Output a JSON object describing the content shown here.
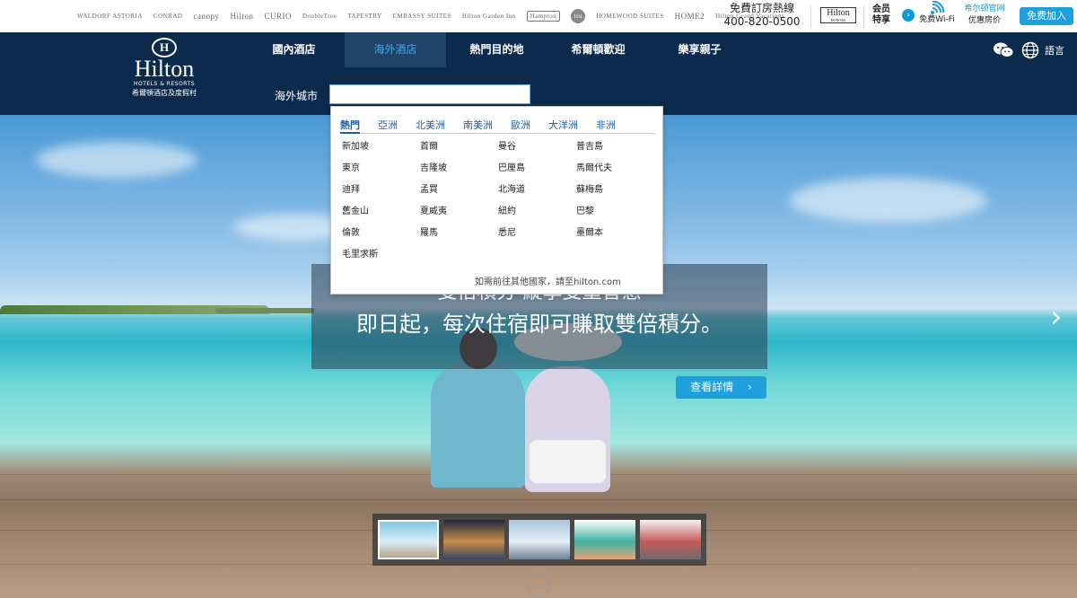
{
  "brands": [
    {
      "name": "WALDORF ASTORIA",
      "style": "small"
    },
    {
      "name": "CONRAD",
      "style": "small"
    },
    {
      "name": "canopy",
      "style": "big"
    },
    {
      "name": "Hilton",
      "style": "big"
    },
    {
      "name": "CURIO",
      "style": "big"
    },
    {
      "name": "DoubleTree",
      "style": "small"
    },
    {
      "name": "TAPESTRY",
      "style": "small"
    },
    {
      "name": "EMBASSY SUITES",
      "style": "small"
    },
    {
      "name": "Hilton Garden Inn",
      "style": "small"
    },
    {
      "name": "Hampton",
      "style": "box"
    },
    {
      "name": "tru",
      "style": "circle"
    },
    {
      "name": "HOMEWOOD SUITES",
      "style": "small"
    },
    {
      "name": "HOME2",
      "style": "big"
    },
    {
      "name": "Hilton Grand Vacations",
      "style": "small"
    }
  ],
  "topbar": {
    "hotline_label": "免費訂房熱線",
    "hotline_number": "400-820-0500",
    "honors_name": "Hilton",
    "honors_sub": "HONORS",
    "member_line1": "会员",
    "member_line2": "特享",
    "wifi_label": "免费Wi-Fi",
    "official_line1": "希尔顿官网",
    "official_line2": "优惠房价",
    "join_label": "免费加入"
  },
  "logo": {
    "mark": "H",
    "name": "Hilton",
    "sub": "HOTELS & RESORTS",
    "cn": "希爾頓酒店及度假村"
  },
  "nav": {
    "tabs": [
      {
        "label": "國內酒店",
        "active": false
      },
      {
        "label": "海外酒店",
        "active": true
      },
      {
        "label": "熱門目的地",
        "active": false
      },
      {
        "label": "希爾頓歡迎",
        "active": false
      },
      {
        "label": "樂享親子",
        "active": false
      }
    ],
    "lang_label": "語言",
    "search_label": "海外城市",
    "search_value": ""
  },
  "dropdown": {
    "regions": [
      {
        "label": "熱門",
        "active": true
      },
      {
        "label": "亞洲",
        "active": false
      },
      {
        "label": "北美洲",
        "active": false
      },
      {
        "label": "南美洲",
        "active": false
      },
      {
        "label": "歐洲",
        "active": false
      },
      {
        "label": "大洋洲",
        "active": false
      },
      {
        "label": "非洲",
        "active": false
      }
    ],
    "cities": [
      "新加坡",
      "首爾",
      "曼谷",
      "普吉島",
      "東京",
      "吉隆坡",
      "巴厘島",
      "馬爾代夫",
      "迪拜",
      "孟買",
      "北海道",
      "蘇梅島",
      "舊金山",
      "夏威夷",
      "紐約",
      "巴黎",
      "倫敦",
      "羅馬",
      "悉尼",
      "墨爾本",
      "毛里求斯"
    ],
    "note": "如需前往其他國家，請至hilton.com"
  },
  "hero": {
    "banner_line1": "雙倍積分 縱享雙重智慧",
    "banner_line2": "即日起，每次住宿即可賺取雙倍積分。",
    "details_label": "查看詳情",
    "details_arrow": "›",
    "next_arrow": "›",
    "scroll_icon": "⌄",
    "thumbnails": [
      {
        "colors": [
          "#7fc6e4",
          "#d9eef6",
          "#b8a48e"
        ],
        "active": true
      },
      {
        "colors": [
          "#1d2a3e",
          "#c98b4a",
          "#354661"
        ],
        "active": false
      },
      {
        "colors": [
          "#aac4dc",
          "#e6eef5",
          "#6f8094"
        ],
        "active": false
      },
      {
        "colors": [
          "#ffffff",
          "#3fb39f",
          "#e6a37c"
        ],
        "active": false
      },
      {
        "colors": [
          "#f4f4f4",
          "#c65a5a",
          "#6c6c6c"
        ],
        "active": false
      }
    ]
  }
}
